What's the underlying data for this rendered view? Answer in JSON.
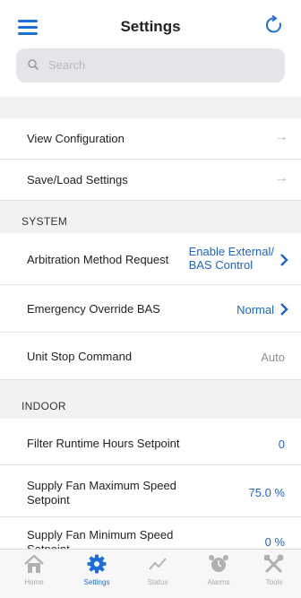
{
  "header": {
    "title": "Settings"
  },
  "search": {
    "placeholder": "Search"
  },
  "rows_top": [
    {
      "label": "View Configuration"
    },
    {
      "label": "Save/Load Settings"
    }
  ],
  "system": {
    "label": "SYSTEM",
    "arbitration": {
      "label": "Arbitration Method Request",
      "value_line1": "Enable External/",
      "value_line2": "BAS Control"
    },
    "emergency": {
      "label": "Emergency Override BAS",
      "value": "Normal"
    },
    "unit_stop": {
      "label": "Unit Stop Command",
      "value": "Auto"
    }
  },
  "indoor": {
    "label": "INDOOR",
    "filter": {
      "label": "Filter Runtime Hours Setpoint",
      "value": "0"
    },
    "fan_max": {
      "label_line1": "Supply Fan Maximum Speed",
      "label_line2": "Setpoint",
      "value": "75.0 %"
    },
    "fan_min": {
      "label_line1": "Supply Fan Minimum Speed",
      "label_line2": "Setpoint",
      "value": "0 %"
    }
  },
  "tabs": [
    {
      "label": "Home"
    },
    {
      "label": "Settings"
    },
    {
      "label": "Status"
    },
    {
      "label": "Alarms"
    },
    {
      "label": "Tools"
    }
  ],
  "colors": {
    "accent": "#1d6fd6",
    "value_blue": "#1f64c6",
    "background": "#f2f2f5"
  }
}
